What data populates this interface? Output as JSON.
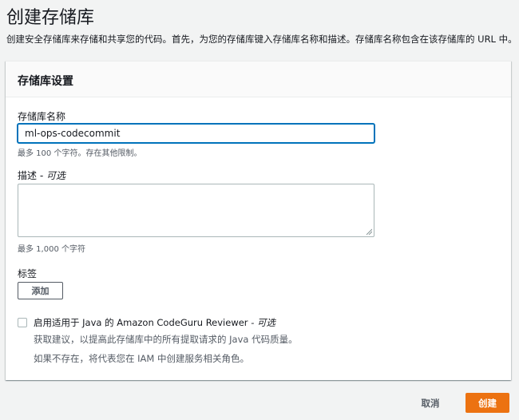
{
  "header": {
    "title": "创建存储库",
    "description": "创建安全存储库来存储和共享您的代码。首先，为您的存储库键入存储库名称和描述。存储库名称包含在该存储库的 URL 中。"
  },
  "settings": {
    "title": "存储库设置",
    "name_label": "存储库名称",
    "name_value": "ml-ops-codecommit",
    "name_hint": "最多 100 个字符。存在其他限制。",
    "desc_label": "描述",
    "desc_optional": "- 可选",
    "desc_value": "",
    "desc_hint": "最多 1,000 个字符",
    "tags_label": "标签",
    "add_label": "添加",
    "codeguru_label": "启用适用于 Java 的 Amazon CodeGuru Reviewer",
    "codeguru_optional": "- 可选",
    "codeguru_checked": false,
    "codeguru_desc1": "获取建议，以提高此存储库中的所有提取请求的 Java 代码质量。",
    "codeguru_desc2": "如果不存在，将代表您在 IAM 中创建服务相关角色。"
  },
  "footer": {
    "cancel_label": "取消",
    "create_label": "创建"
  },
  "colors": {
    "primary": "#ec7211",
    "focus": "#0073bb",
    "background": "#f2f3f3"
  },
  "icons": {
    "resize": "resize-grip-icon"
  }
}
